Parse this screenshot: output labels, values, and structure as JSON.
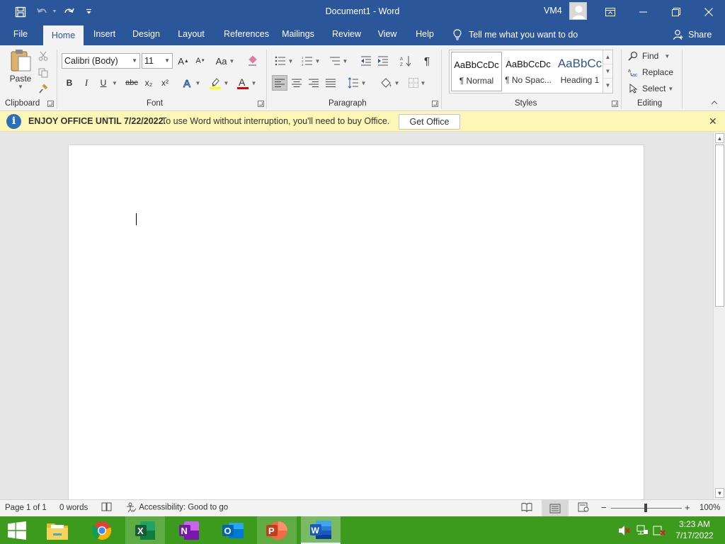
{
  "window": {
    "title": "Document1  -  Word",
    "user": "VM4"
  },
  "tabs": [
    "File",
    "Home",
    "Insert",
    "Design",
    "Layout",
    "References",
    "Mailings",
    "Review",
    "View",
    "Help"
  ],
  "tell_me": "Tell me what you want to do",
  "share": "Share",
  "ribbon": {
    "clipboard": {
      "paste": "Paste",
      "label": "Clipboard"
    },
    "font": {
      "family": "Calibri (Body)",
      "size": "11",
      "label": "Font",
      "aa": "Aa",
      "bold": "B",
      "italic": "I",
      "underline": "U",
      "strike": "abc",
      "sub": "x₂",
      "sup": "x²",
      "font_color": "#e00000",
      "highlight_color": "#ffff00"
    },
    "paragraph": {
      "label": "Paragraph",
      "pilcrow": "¶"
    },
    "styles": {
      "label": "Styles",
      "items": [
        {
          "sample": "AaBbCcDc",
          "name": "¶ Normal"
        },
        {
          "sample": "AaBbCcDc",
          "name": "¶ No Spac..."
        },
        {
          "sample": "AaBbCc",
          "name": "Heading 1"
        }
      ]
    },
    "editing": {
      "find": "Find",
      "replace": "Replace",
      "select": "Select",
      "label": "Editing"
    }
  },
  "infobar": {
    "title": "ENJOY OFFICE UNTIL 7/22/2022.",
    "text": "To use Word without interruption, you'll need to buy Office.",
    "button": "Get Office"
  },
  "status": {
    "page": "Page 1 of 1",
    "words": "0 words",
    "accessibility": "Accessibility: Good to go",
    "zoom": "100%"
  },
  "clock": {
    "time": "3:23 AM",
    "date": "7/17/2022"
  },
  "colors": {
    "accent": "#2b579a",
    "taskbar": "#3c9a1c",
    "infobar": "#fcf7b6"
  }
}
